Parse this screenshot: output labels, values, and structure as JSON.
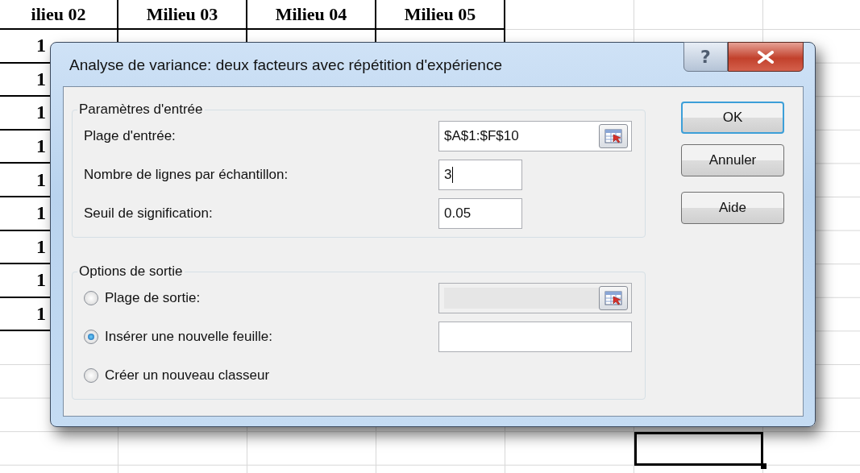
{
  "spreadsheet": {
    "columns": [
      "ilieu 02",
      "Milieu 03",
      "Milieu 04",
      "Milieu 05"
    ],
    "rows": [
      {
        "cells": [
          {
            "text": "1",
            "selected": false
          }
        ]
      },
      {
        "cells": [
          {
            "text": "1",
            "selected": false
          }
        ]
      },
      {
        "cells": [
          {
            "text": "1",
            "selected": false
          }
        ]
      },
      {
        "cells": [
          {
            "text": "1",
            "selected": false
          }
        ]
      },
      {
        "cells": [
          {
            "text": "1",
            "selected": false
          }
        ]
      },
      {
        "cells": [
          {
            "text": "1",
            "selected": false
          }
        ]
      },
      {
        "cells": [
          {
            "text": "1",
            "selected": false
          }
        ]
      },
      {
        "cells": [
          {
            "text": "1",
            "selected": false
          }
        ]
      },
      {
        "cells": [
          {
            "text": "1",
            "selected": false
          }
        ]
      },
      {},
      {},
      {},
      {
        "active_cell": {
          "selected": true
        }
      }
    ]
  },
  "dialog": {
    "title": "Analyse de variance: deux facteurs avec répétition d'expérience",
    "help_button": "?",
    "groups": [
      {
        "title": "Paramètres d'entrée",
        "rows": [
          {
            "kind": "field",
            "label": "Plage d'entrée:",
            "value": "$A$1:$F$10",
            "range_picker": true,
            "disabled": false
          },
          {
            "kind": "field",
            "label": "Nombre de lignes par échantillon:",
            "value": "3",
            "focused": true,
            "disabled": false
          },
          {
            "kind": "field",
            "label": "Seuil de signification:",
            "value": "0.05",
            "disabled": false
          }
        ]
      },
      {
        "title": "Options de sortie",
        "rows": [
          {
            "kind": "radio",
            "label": "Plage de sortie:",
            "selected": false,
            "field": {
              "range_picker": true,
              "disabled": true
            }
          },
          {
            "kind": "radio",
            "label": "Insérer une nouvelle feuille:",
            "selected": true,
            "field": {
              "disabled": false
            }
          },
          {
            "kind": "radio",
            "label": "Créer un nouveau classeur",
            "selected": false
          }
        ]
      }
    ],
    "buttons": [
      {
        "label": "OK",
        "default": true
      },
      {
        "label": "Annuler",
        "default": false
      },
      {
        "label": "Aide",
        "default": false
      }
    ]
  }
}
